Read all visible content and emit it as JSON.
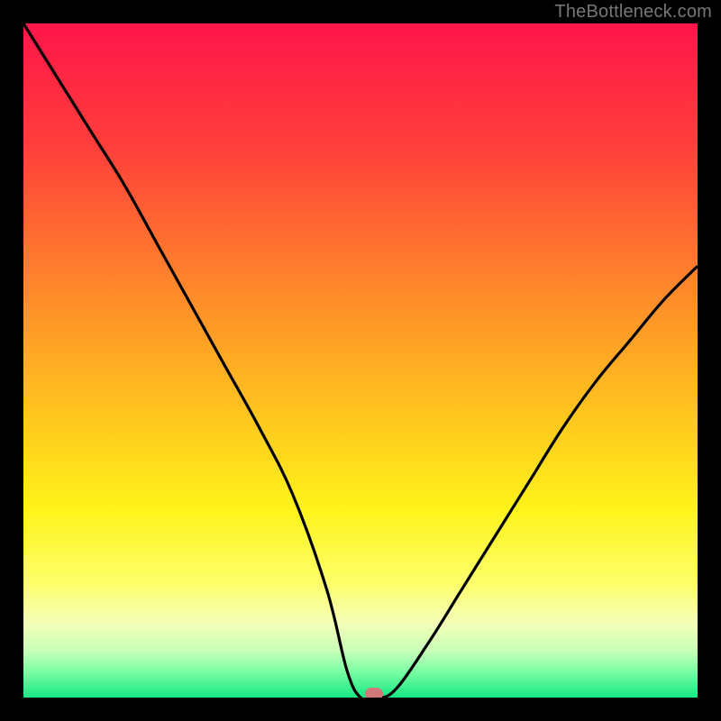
{
  "attribution": "TheBottleneck.com",
  "colors": {
    "frame": "#000000",
    "curve": "#000000",
    "marker": "#cf7a78",
    "gradient_stops": [
      {
        "pct": 0,
        "color": "#ff154a"
      },
      {
        "pct": 18,
        "color": "#ff3e3b"
      },
      {
        "pct": 40,
        "color": "#ff8a2a"
      },
      {
        "pct": 58,
        "color": "#ffc51e"
      },
      {
        "pct": 72,
        "color": "#fff31a"
      },
      {
        "pct": 83,
        "color": "#fdff6a"
      },
      {
        "pct": 89,
        "color": "#f4ffb8"
      },
      {
        "pct": 93,
        "color": "#c9ffb8"
      },
      {
        "pct": 96,
        "color": "#7effa6"
      },
      {
        "pct": 100,
        "color": "#17e884"
      }
    ]
  },
  "chart_data": {
    "type": "line",
    "title": "",
    "xlabel": "",
    "ylabel": "",
    "xlim": [
      0,
      100
    ],
    "ylim": [
      0,
      100
    ],
    "grid": false,
    "legend": false,
    "series": [
      {
        "name": "bottleneck-curve",
        "x": [
          0,
          5,
          10,
          15,
          20,
          25,
          30,
          35,
          40,
          45,
          48,
          50,
          52,
          55,
          60,
          65,
          70,
          75,
          80,
          85,
          90,
          95,
          100
        ],
        "y": [
          100,
          92,
          84,
          76,
          67,
          58,
          49,
          40,
          30,
          16,
          4,
          0,
          0,
          1,
          8,
          16,
          24,
          32,
          40,
          47,
          53,
          59,
          64
        ]
      }
    ],
    "marker": {
      "x": 52,
      "y": 0.5
    }
  }
}
